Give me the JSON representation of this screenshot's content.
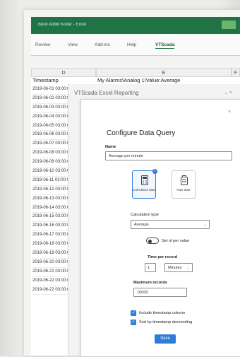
{
  "app": {
    "window_title": "Book Addin Koder - Excel",
    "ribbon_tabs": [
      "Review",
      "View",
      "Add-ins",
      "Help",
      "VTScada"
    ],
    "active_tab": "VTScada"
  },
  "sheet": {
    "columns": [
      "D",
      "E",
      "F"
    ],
    "col_d_header": "Timestamp",
    "col_e_header": "My Alarms\\Analog 1\\Value:Average",
    "timestamps": [
      "2019-06-01 03:00:00",
      "2019-06-02 03:00:00",
      "2019-06-03 03:00:00",
      "2019-06-04 03:00:00",
      "2019-06-05 03:00:00",
      "2019-06-06 03:00:00",
      "2019-06-07 03:00:00",
      "2019-06-08 03:00:00",
      "2019-06-09 03:00:00",
      "2019-06-10 03:00:00",
      "2019-06-11 03:00:00",
      "2019-06-12 03:00:00",
      "2019-06-13 03:00:00",
      "2019-06-14 03:00:00",
      "2019-06-15 03:00:00",
      "2019-06-16 03:00:00",
      "2019-06-17 03:00:00",
      "2019-06-18 03:00:00",
      "2019-06-19 03:00:00",
      "2019-06-20 03:00:00",
      "2019-06-21 03:00:00",
      "2019-06-22 03:00:00",
      "2019-06-22 03:00:00"
    ]
  },
  "taskpane": {
    "title": "VTScada Excel Reporting",
    "icons": "⌄ ×"
  },
  "dialog": {
    "close": "×",
    "title": "Configure Data Query",
    "name_label": "Name",
    "name_value": "Average per minute",
    "options": [
      {
        "caption": "Calculated data",
        "selected": true
      },
      {
        "caption": "Raw data",
        "selected": false
      }
    ],
    "calc_label": "Calculation type",
    "calc_value": "Average",
    "toggle_label": "Set of per value",
    "time_label": "Time per record",
    "time_value": "1",
    "time_unit": "Minutes",
    "max_label": "Maximum records",
    "max_value": "10000",
    "check1_label": "Include timestamp column",
    "check2_label": "Sort by timestamp descending",
    "save_label": "Save",
    "check_mark": "✓",
    "chevron": "⌄"
  },
  "colors": {
    "excel_green": "#217346",
    "accent_blue": "#2f7bd8"
  }
}
